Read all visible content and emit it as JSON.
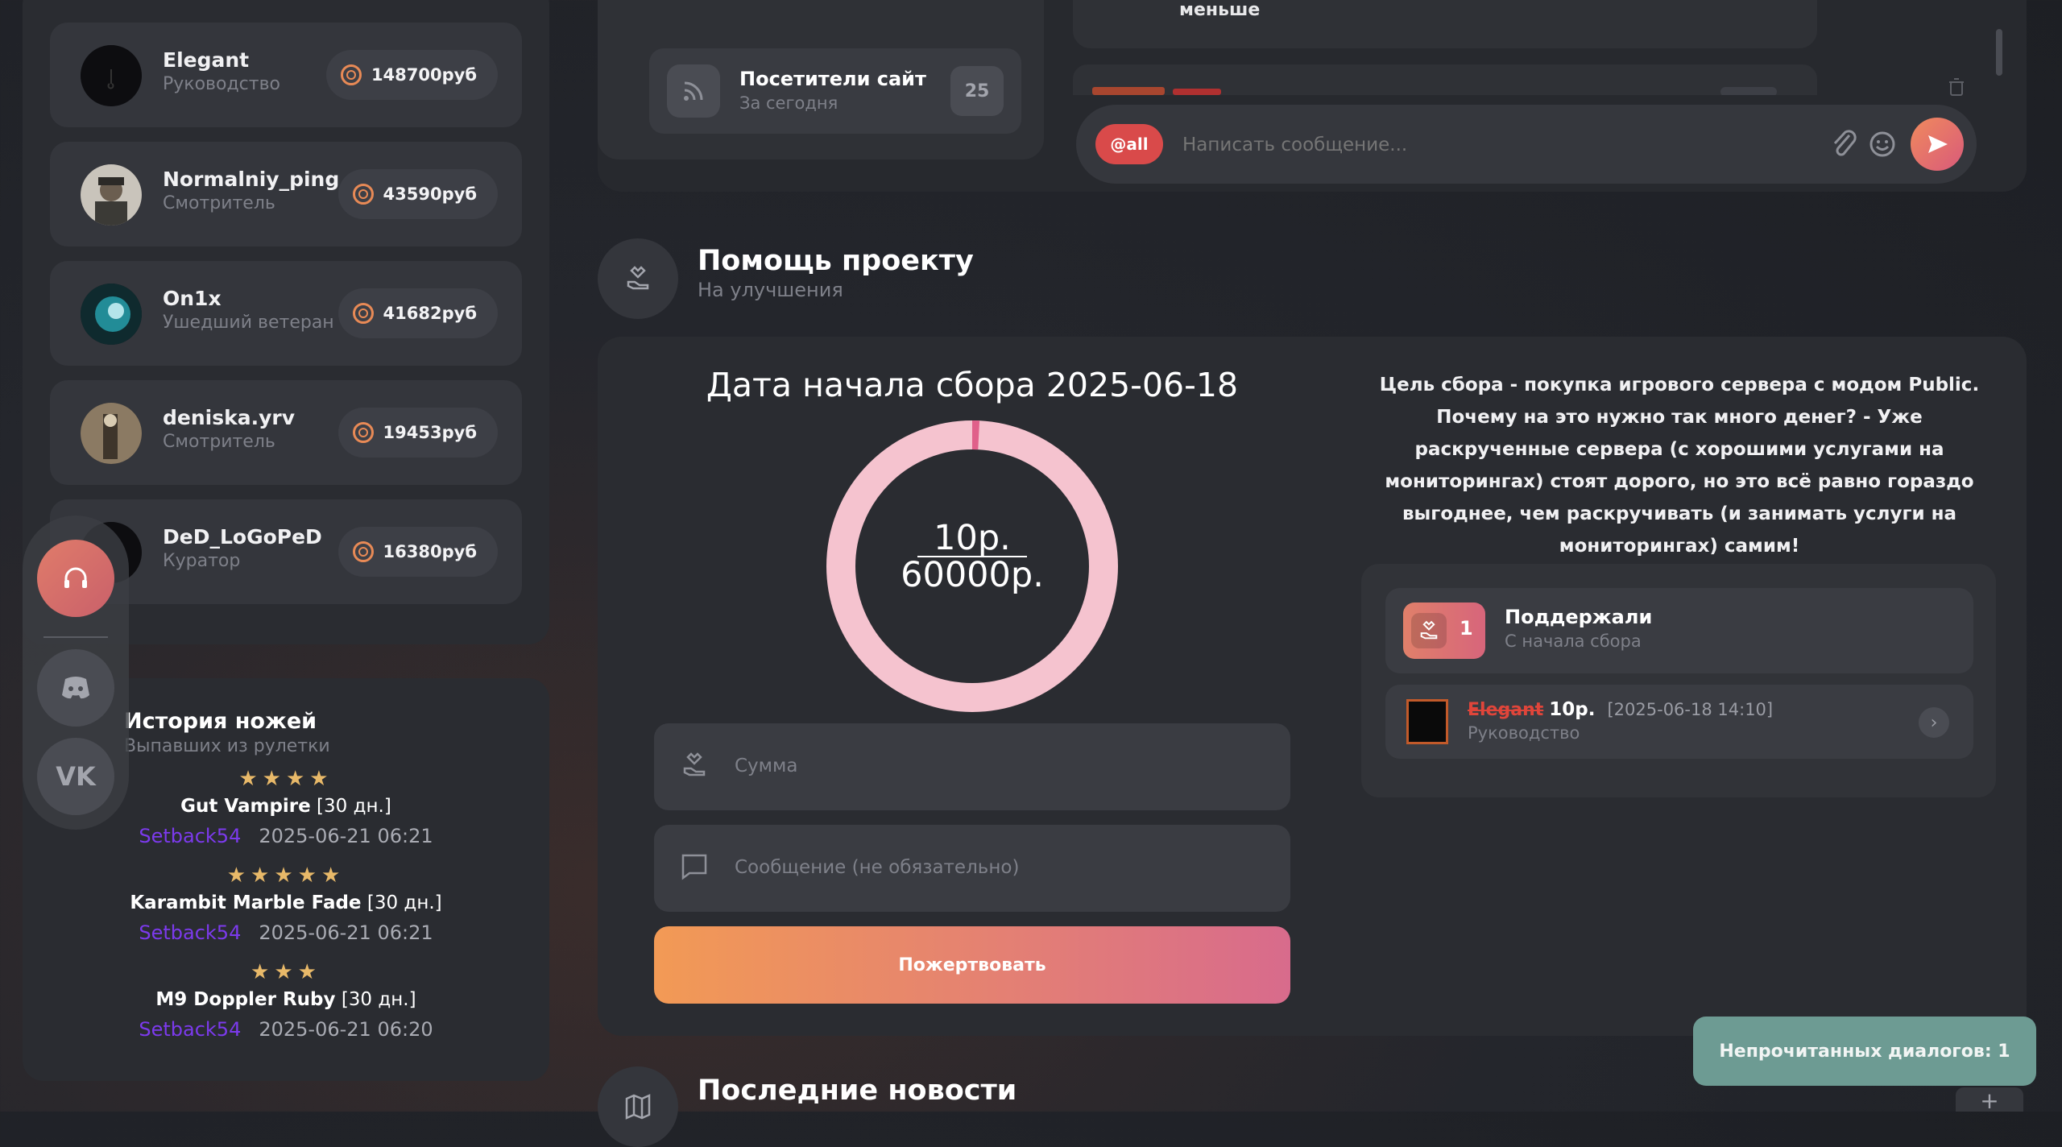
{
  "leaderboard": [
    {
      "name": "Elegant",
      "role": "Руководство",
      "amount": "148700руб",
      "avatar": "black"
    },
    {
      "name": "Normalniy_ping",
      "role": "Смотритель",
      "amount": "43590руб",
      "avatar": "portrait"
    },
    {
      "name": "On1x",
      "role": "Ушедший ветеран",
      "amount": "41682руб",
      "avatar": "teal"
    },
    {
      "name": "deniska.yrv",
      "role": "Смотритель",
      "amount": "19453руб",
      "avatar": "brown"
    },
    {
      "name": "DeD_LoGoPeD",
      "role": "Куратор",
      "amount": "16380руб",
      "avatar": "black"
    }
  ],
  "knives": {
    "title": "История ножей",
    "subtitle": "Выпавших из рулетки",
    "items": [
      {
        "stars": "★★★★",
        "name": "Gut Vampire",
        "duration": "[30 дн.]",
        "user": "Setback54",
        "date": "2025-06-21 06:21"
      },
      {
        "stars": "★★★★★",
        "name": "Karambit Marble Fade",
        "duration": "[30 дн.]",
        "user": "Setback54",
        "date": "2025-06-21 06:21"
      },
      {
        "stars": "★★★",
        "name": "M9 Doppler Ruby",
        "duration": "[30 дн.]",
        "user": "Setback54",
        "date": "2025-06-21 06:20"
      }
    ]
  },
  "visitors": {
    "title": "Посетители сайт",
    "subtitle": "За сегодня",
    "count": "25"
  },
  "chat": {
    "partial_text": "меньше",
    "mention_label": "@all",
    "input_placeholder": "Написать сообщение..."
  },
  "donation": {
    "section_title": "Помощь проекту",
    "section_subtitle": "На улучшения",
    "start_date_title": "Дата начала сбора 2025-06-18",
    "collected": "10р.",
    "goal": "60000р.",
    "progress_fraction": 0.00017,
    "amount_placeholder": "Сумма",
    "message_placeholder": "Сообщение (не обязательно)",
    "button_label": "Пожертвовать",
    "description": "Цель сбора - покупка игрового сервера с модом Public. Почему на это нужно так много денег? - Уже раскрученные сервера (с хорошими услугами на мониторингах) стоят дорого, но это всё равно гораздо выгоднее, чем раскручивать (и занимать услуги на мониторингах) самим!",
    "supporters_count": "1",
    "supporters_title": "Поддержали",
    "supporters_subtitle": "С начала сбора",
    "donor": {
      "name": "Elegant",
      "amount": "10р.",
      "date": "[2025-06-18 14:10]",
      "role": "Руководство"
    }
  },
  "news": {
    "title": "Последние новости"
  },
  "toast": {
    "text": "Непрочитанных диалогов: 1"
  },
  "colors": {
    "accent_orange": "#f29a55",
    "accent_pink": "#d86b8c",
    "ring": "#f5c3cf",
    "donor_name": "#e0453a",
    "username_purple": "#7c3aed",
    "toast_bg": "#6d9b93"
  }
}
